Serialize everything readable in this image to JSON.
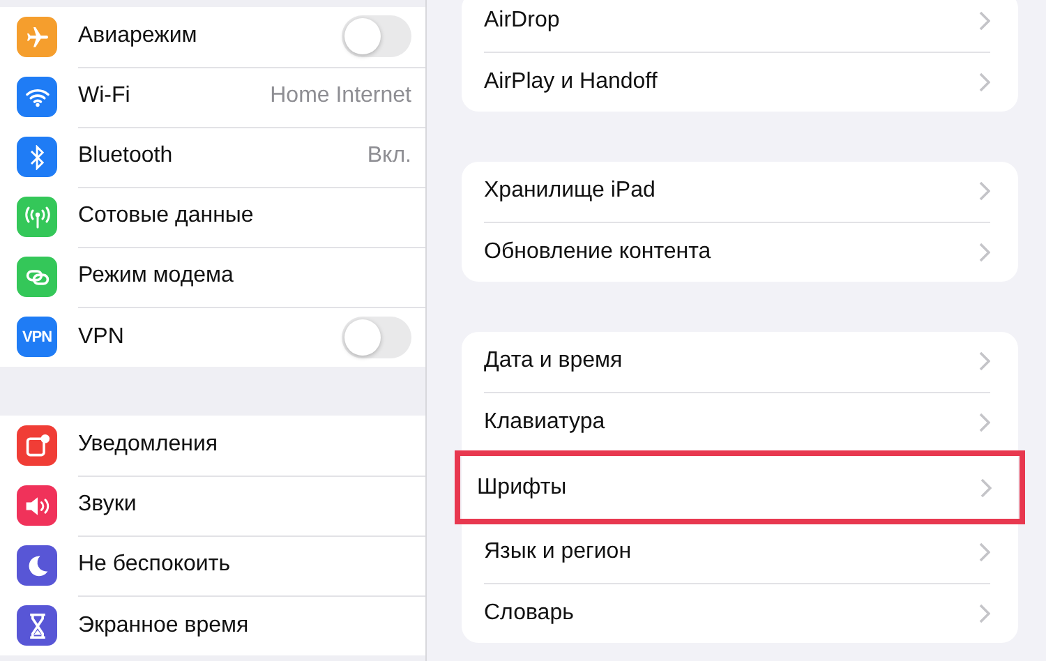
{
  "sidebar": {
    "groups": [
      {
        "items": [
          {
            "label": "Авиарежим",
            "kind": "toggle",
            "on": false
          },
          {
            "label": "Wi-Fi",
            "kind": "value",
            "value": "Home Internet"
          },
          {
            "label": "Bluetooth",
            "kind": "value",
            "value": "Вкл."
          },
          {
            "label": "Сотовые данные",
            "kind": "plain"
          },
          {
            "label": "Режим модема",
            "kind": "plain"
          },
          {
            "label": "VPN",
            "icon_text": "VPN",
            "kind": "toggle",
            "on": false
          }
        ]
      },
      {
        "items": [
          {
            "label": "Уведомления",
            "kind": "plain"
          },
          {
            "label": "Звуки",
            "kind": "plain"
          },
          {
            "label": "Не беспокоить",
            "kind": "plain"
          },
          {
            "label": "Экранное время",
            "kind": "plain"
          }
        ]
      }
    ]
  },
  "settings": {
    "groups": [
      {
        "items": [
          {
            "label": "AirDrop",
            "highlighted": false
          },
          {
            "label": "AirPlay и Handoff",
            "highlighted": false
          }
        ]
      },
      {
        "items": [
          {
            "label": "Хранилище iPad",
            "highlighted": false
          },
          {
            "label": "Обновление контента",
            "highlighted": false
          }
        ]
      },
      {
        "items": [
          {
            "label": "Дата и время",
            "highlighted": false
          },
          {
            "label": "Клавиатура",
            "highlighted": false
          },
          {
            "label": "Шрифты",
            "highlighted": true
          },
          {
            "label": "Язык и регион",
            "highlighted": false
          },
          {
            "label": "Словарь",
            "highlighted": false
          }
        ]
      }
    ]
  }
}
